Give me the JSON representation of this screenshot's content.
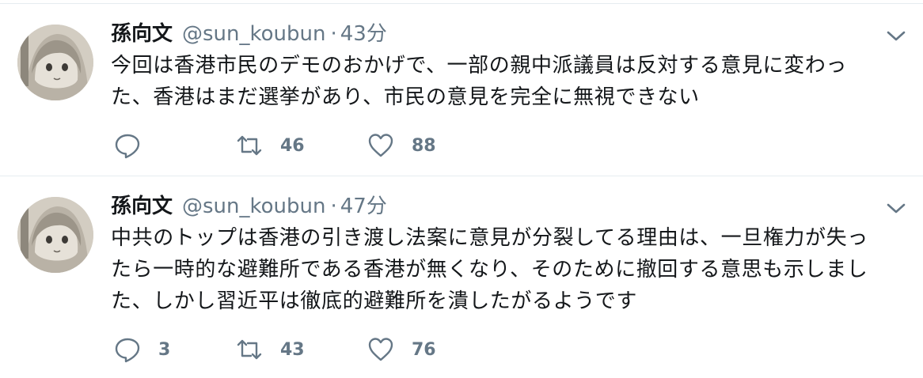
{
  "tweets": [
    {
      "name": "孫向文",
      "handle": "@sun_koubun",
      "separator": "·",
      "time": "43分",
      "text": "今回は香港市民のデモのおかげで、一部の親中派議員は反対する意見に変わっ\nた、香港はまだ選挙があり、市民の意見を完全に無視できない",
      "reply_count": "",
      "retweet_count": "46",
      "like_count": "88"
    },
    {
      "name": "孫向文",
      "handle": "@sun_koubun",
      "separator": "·",
      "time": "47分",
      "text": "中共のトップは香港の引き渡し法案に意見が分裂してる理由は、一旦権力が失っ\nたら一時的な避難所である香港が無くなり、そのために撤回する意思も示しまし\nた、しかし習近平は徹底的避難所を潰したがるようです",
      "reply_count": "3",
      "retweet_count": "43",
      "like_count": "76"
    }
  ],
  "icons": {
    "reply": "reply-icon",
    "retweet": "retweet-icon",
    "like": "heart-icon",
    "menu": "chevron-down-icon"
  },
  "colors": {
    "text": "#14171a",
    "secondary": "#657786",
    "border": "#e6ecf0"
  }
}
